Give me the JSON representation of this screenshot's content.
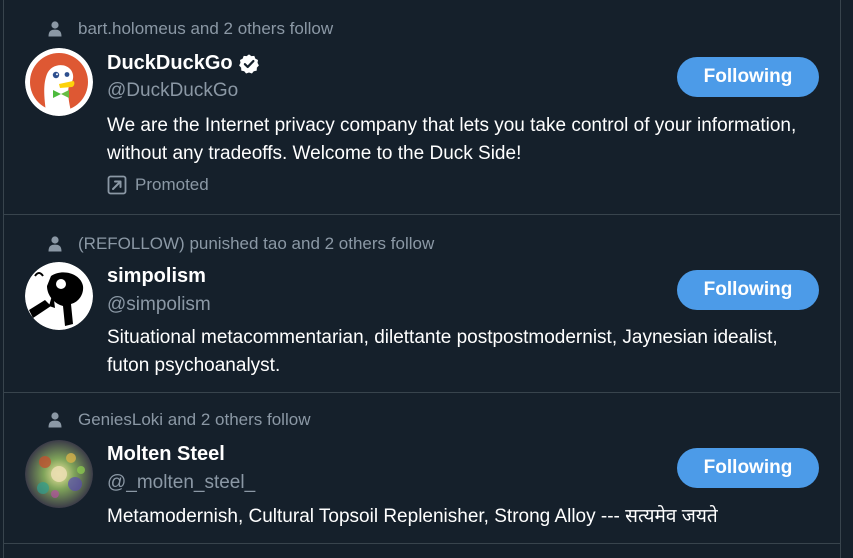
{
  "users": [
    {
      "social_context": "bart.holomeus and 2 others follow",
      "name": "DuckDuckGo",
      "verified": true,
      "handle": "@DuckDuckGo",
      "bio": "We are the Internet privacy company that lets you take control of your information, without any tradeoffs. Welcome to the Duck Side!",
      "promoted_label": "Promoted",
      "button_label": "Following"
    },
    {
      "social_context": "(REFOLLOW) punished tao and 2 others follow",
      "name": "simpolism",
      "verified": false,
      "handle": "@simpolism",
      "bio": "Situational metacommentarian, dilettante postpostmodernist, Jaynesian idealist, futon psychoanalyst.",
      "button_label": "Following"
    },
    {
      "social_context": "GeniesLoki and 2 others follow",
      "name": "Molten Steel",
      "verified": false,
      "handle": "@_molten_steel_",
      "bio": "Metamodernish, Cultural Topsoil Replenisher, Strong Alloy --- सत्यमेव जयते",
      "button_label": "Following"
    }
  ],
  "colors": {
    "background": "#15202b",
    "border": "#38444d",
    "text_primary": "#ffffff",
    "text_secondary": "#8b98a5",
    "button": "#4c9be8",
    "duck_bg": "#de5833"
  }
}
